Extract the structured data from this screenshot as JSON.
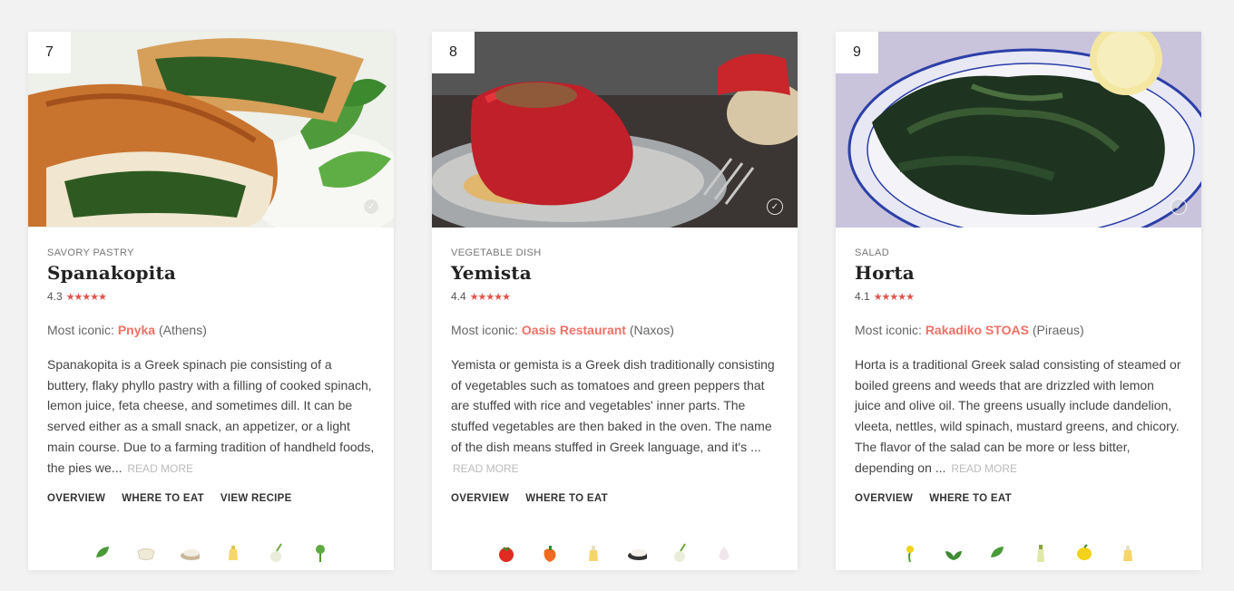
{
  "cards": [
    {
      "rank": "7",
      "category": "SAVORY PASTRY",
      "name": "Spanakopita",
      "rating": "4.3",
      "stars": "★★★★★",
      "iconic_label": "Most iconic:",
      "place": "Pnyka",
      "city": "(Athens)",
      "description": "Spanakopita is a Greek spinach pie consisting of a buttery, flaky phyllo pastry with a filling of cooked spinach, lemon juice, feta cheese, and sometimes dill. It can be served either as a small snack, an appetizer, or a light main course. Due to a farming tradition of handheld foods, the pies we...",
      "read_more": "READ MORE",
      "links": [
        "OVERVIEW",
        "WHERE TO EAT",
        "VIEW RECIPE"
      ],
      "ingredient_icons": [
        "spinach-icon",
        "phyllo-icon",
        "feta-icon",
        "butter-icon",
        "onion-icon",
        "dill-icon"
      ]
    },
    {
      "rank": "8",
      "category": "VEGETABLE DISH",
      "name": "Yemista",
      "rating": "4.4",
      "stars": "★★★★★",
      "iconic_label": "Most iconic:",
      "place": "Oasis Restaurant",
      "city": "(Naxos)",
      "description": "Yemista or gemista is a Greek dish traditionally consisting of vegetables such as tomatoes and green peppers that are stuffed with rice and vegetables' inner parts. The stuffed vegetables are then baked in the oven. The name of the dish means stuffed in Greek language, and it's ...",
      "read_more": "READ MORE",
      "links": [
        "OVERVIEW",
        "WHERE TO EAT"
      ],
      "ingredient_icons": [
        "tomato-icon",
        "pepper-icon",
        "oil-icon",
        "rice-icon",
        "onion-icon",
        "garlic-icon"
      ]
    },
    {
      "rank": "9",
      "category": "SALAD",
      "name": "Horta",
      "rating": "4.1",
      "stars": "★★★★★",
      "iconic_label": "Most iconic:",
      "place": "Rakadiko STOAS",
      "city": "(Piraeus)",
      "description": "Horta is a traditional Greek salad consisting of steamed or boiled greens and weeds that are drizzled with lemon juice and olive oil. The greens usually include dandelion, vleeta, nettles, wild spinach, mustard greens, and chicory. The flavor of the salad can be more or less bitter, depending on ...",
      "read_more": "READ MORE",
      "links": [
        "OVERVIEW",
        "WHERE TO EAT"
      ],
      "ingredient_icons": [
        "dandelion-icon",
        "herbs-icon",
        "spinach-icon",
        "olive-oil-icon",
        "lemon-icon",
        "oil-icon"
      ]
    }
  ],
  "colors": {
    "accent": "#f07167",
    "stars": "#e3524b"
  }
}
